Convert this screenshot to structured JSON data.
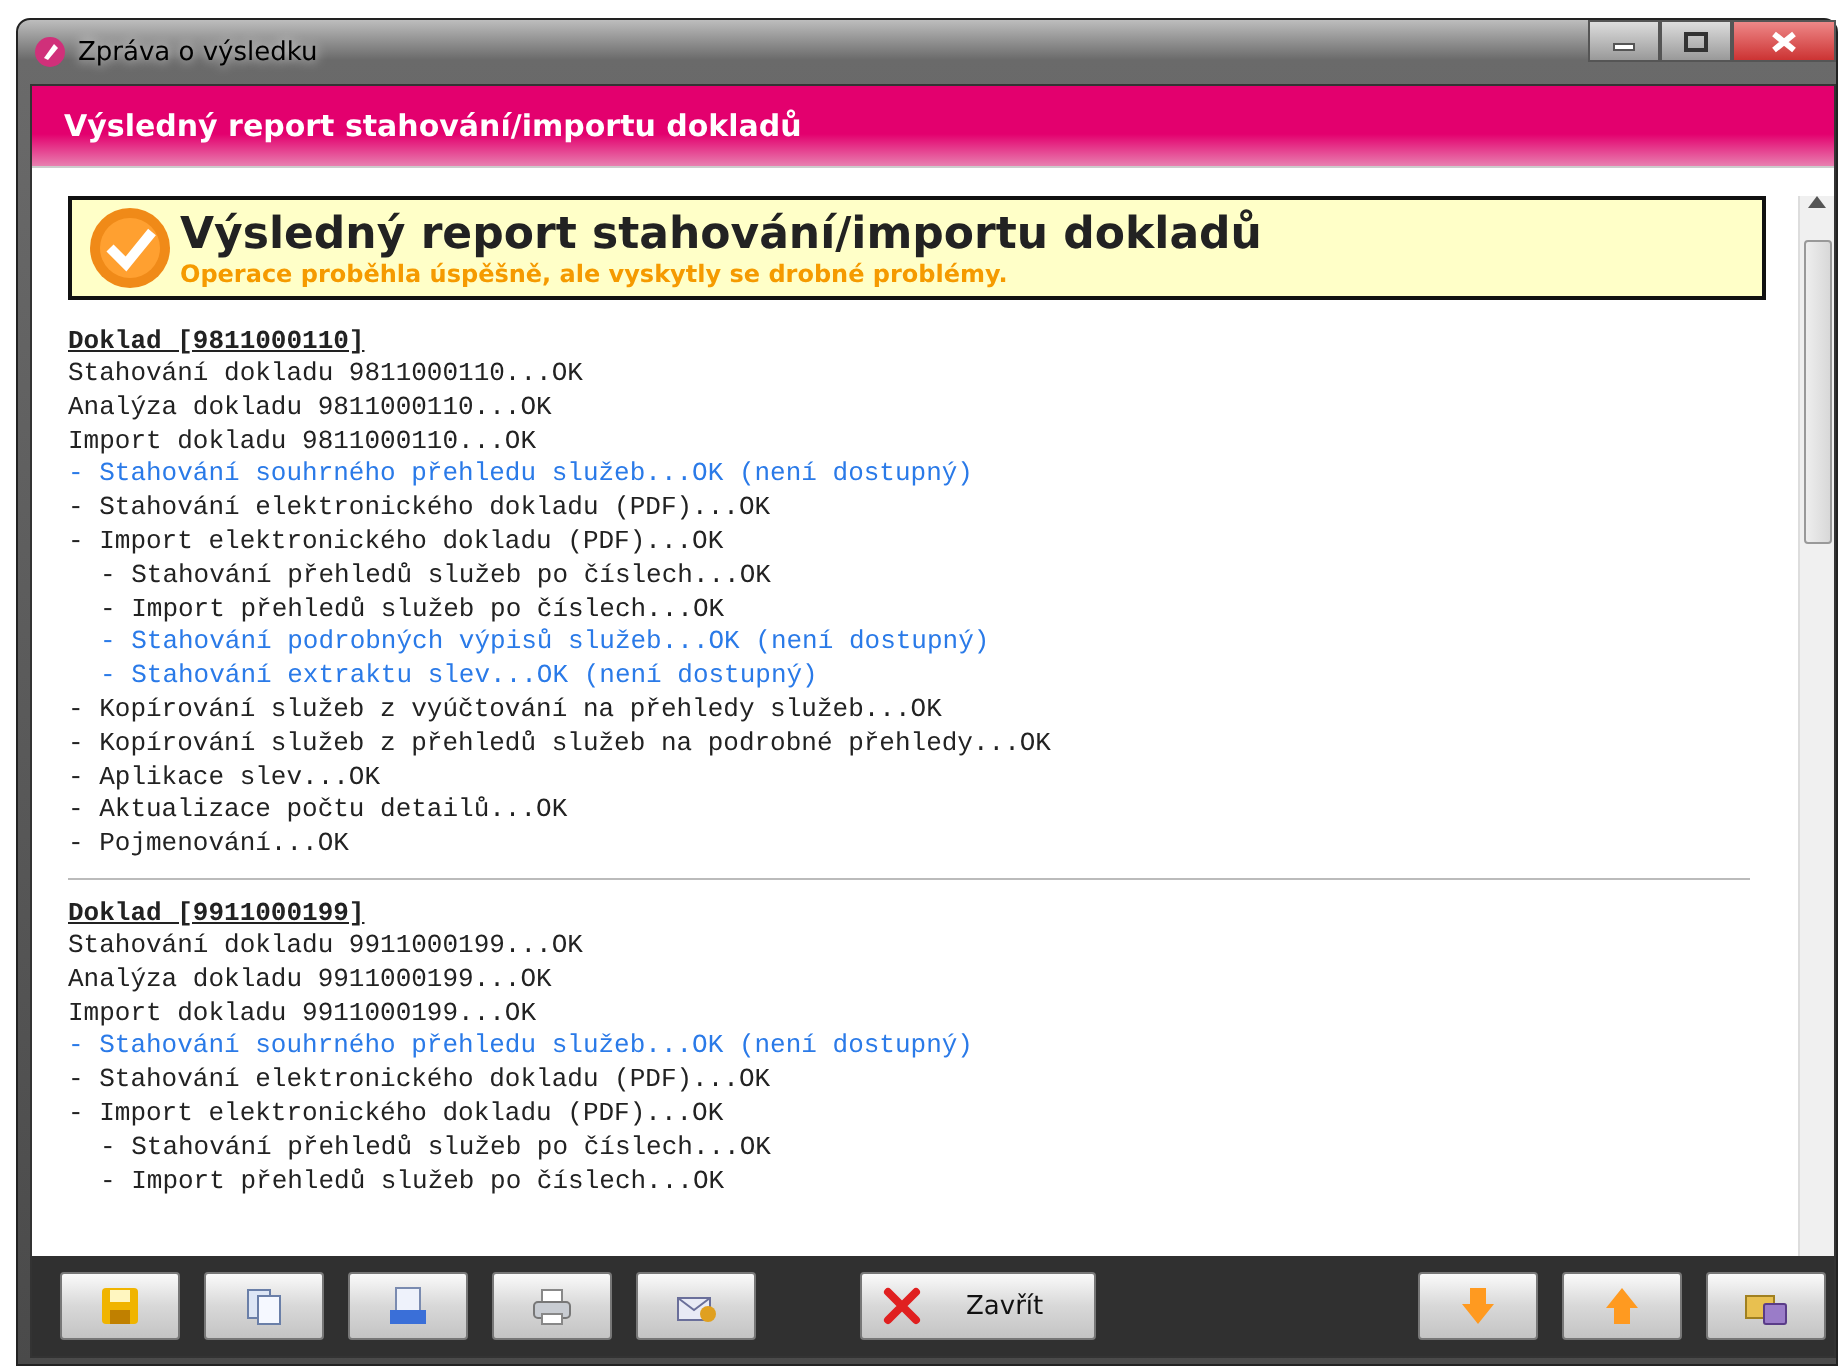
{
  "window": {
    "title": "Zpráva o výsledku"
  },
  "header": {
    "title": "Výsledný report stahování/importu dokladů"
  },
  "summary": {
    "title": "Výsledný report stahování/importu dokladů",
    "message": "Operace proběhla úspěšně, ale vyskytly se drobné problémy."
  },
  "documents": [
    {
      "heading": "Doklad [9811000110]",
      "lines": [
        {
          "text": "Stahování dokladu 9811000110...OK",
          "unavailable": false
        },
        {
          "text": "Analýza dokladu 9811000110...OK",
          "unavailable": false
        },
        {
          "text": "Import dokladu 9811000110...OK",
          "unavailable": false
        },
        {
          "text": "- Stahování souhrného přehledu služeb...OK (není dostupný)",
          "unavailable": true
        },
        {
          "text": "- Stahování elektronického dokladu (PDF)...OK",
          "unavailable": false
        },
        {
          "text": "- Import elektronického dokladu (PDF)...OK",
          "unavailable": false,
          "children": [
            {
              "text": "- Stahování přehledů služeb po číslech...OK",
              "unavailable": false
            },
            {
              "text": "- Import přehledů služeb po číslech...OK",
              "unavailable": false
            },
            {
              "text": "- Stahování podrobných výpisů služeb...OK (není dostupný)",
              "unavailable": true
            },
            {
              "text": "- Stahování extraktu slev...OK (není dostupný)",
              "unavailable": true
            }
          ]
        },
        {
          "text": "- Kopírování služeb z vyúčtování na přehledy služeb...OK",
          "unavailable": false
        },
        {
          "text": "- Kopírování služeb z přehledů služeb na podrobné přehledy...OK",
          "unavailable": false
        },
        {
          "text": "- Aplikace slev...OK",
          "unavailable": false
        },
        {
          "text": "- Aktualizace počtu detailů...OK",
          "unavailable": false
        },
        {
          "text": "- Pojmenování...OK",
          "unavailable": false
        }
      ]
    },
    {
      "heading": "Doklad [9911000199]",
      "lines": [
        {
          "text": "Stahování dokladu 9911000199...OK",
          "unavailable": false
        },
        {
          "text": "Analýza dokladu 9911000199...OK",
          "unavailable": false
        },
        {
          "text": "Import dokladu 9911000199...OK",
          "unavailable": false
        },
        {
          "text": "- Stahování souhrného přehledu služeb...OK (není dostupný)",
          "unavailable": true
        },
        {
          "text": "- Stahování elektronického dokladu (PDF)...OK",
          "unavailable": false
        },
        {
          "text": "- Import elektronického dokladu (PDF)...OK",
          "unavailable": false,
          "children": [
            {
              "text": "- Stahování přehledů služeb po číslech...OK",
              "unavailable": false
            },
            {
              "text": "- Import přehledů služeb po číslech...OK",
              "unavailable": false
            }
          ]
        }
      ]
    }
  ],
  "toolbar": {
    "buttons": [
      {
        "kind": "save"
      },
      {
        "kind": "copy"
      },
      {
        "kind": "html"
      },
      {
        "kind": "print"
      },
      {
        "kind": "email"
      },
      {
        "kind": "close",
        "label": "Zavřít"
      },
      {
        "kind": "down"
      },
      {
        "kind": "up"
      },
      {
        "kind": "export"
      }
    ]
  }
}
